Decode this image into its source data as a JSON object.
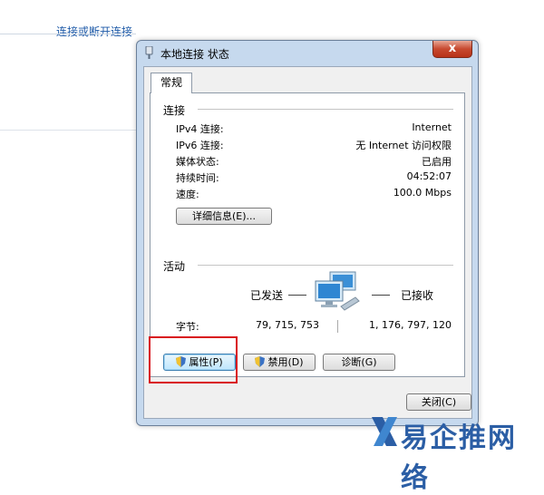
{
  "background": {
    "link_text": "连接或断开连接"
  },
  "window": {
    "title": "本地连接 状态",
    "close_glyph": "x"
  },
  "tabs": [
    {
      "label": "常规"
    }
  ],
  "connection": {
    "header": "连接",
    "rows": [
      {
        "label": "IPv4 连接:",
        "value": "Internet"
      },
      {
        "label": "IPv6 连接:",
        "value": "无 Internet 访问权限"
      },
      {
        "label": "媒体状态:",
        "value": "已启用"
      },
      {
        "label": "持续时间:",
        "value": "04:52:07"
      },
      {
        "label": "速度:",
        "value": "100.0 Mbps"
      }
    ],
    "details_button": "详细信息(E)..."
  },
  "activity": {
    "header": "活动",
    "sent_label": "已发送",
    "received_label": "已接收",
    "bytes_label": "字节:",
    "bytes_sent": "79, 715, 753",
    "bytes_received": "1, 176, 797, 120"
  },
  "buttons": {
    "properties": "属性(P)",
    "disable": "禁用(D)",
    "diagnose": "诊断(G)",
    "close": "关闭(C)"
  },
  "watermark": {
    "text": "易企推网络"
  },
  "colors": {
    "highlight": "#d9121a",
    "link": "#1e5aa8",
    "watermark": "#2b5ea5"
  }
}
